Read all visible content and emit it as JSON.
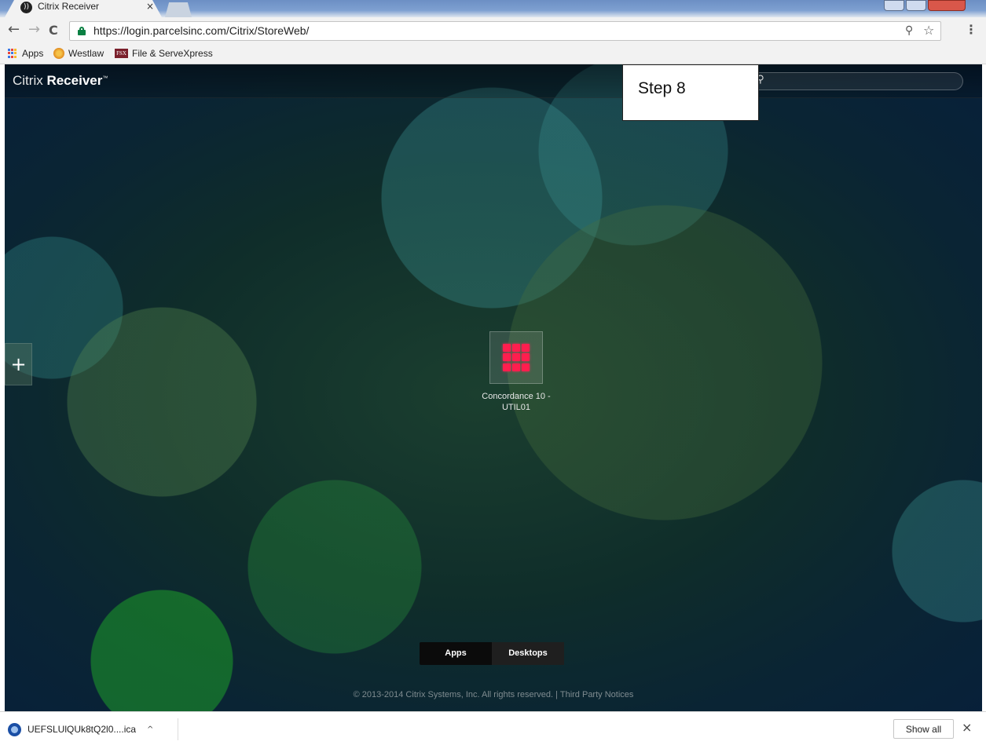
{
  "browser": {
    "tab_title": "Citrix Receiver",
    "tab_close": "×",
    "url": "https://login.parcelsinc.com/Citrix/StoreWeb/",
    "nav": {
      "back": "←",
      "forward": "→",
      "reload": "C"
    },
    "omnibox_icons": {
      "key": "⚲",
      "star": "☆",
      "menu": "⋮"
    },
    "bookmarks": [
      {
        "label": "Apps",
        "icon": "apps-grid-icon"
      },
      {
        "label": "Westlaw",
        "icon": "westlaw-icon"
      },
      {
        "label": "File & ServeXpress",
        "icon": "fsx-icon",
        "icon_text": "FSX"
      }
    ]
  },
  "citrix": {
    "brand_light": "Citrix",
    "brand_bold": "Receiver",
    "brand_tm": "™",
    "search_icon": "⚲",
    "step_annotation": "Step 8",
    "add_button": "+",
    "app": {
      "name_line1": "Concordance 10 -",
      "name_line2": "UTIL01",
      "icon_color": "#ff1e4e"
    },
    "views": [
      {
        "label": "Apps",
        "selected": true
      },
      {
        "label": "Desktops",
        "selected": false
      }
    ],
    "footer": "© 2013-2014 Citrix Systems, Inc. All rights reserved.  |  Third Party Notices"
  },
  "download_bar": {
    "file_name": "UEFSLUlQUk8tQ2l0....ica",
    "caret": "^",
    "show_all": "Show all",
    "close": "×"
  }
}
